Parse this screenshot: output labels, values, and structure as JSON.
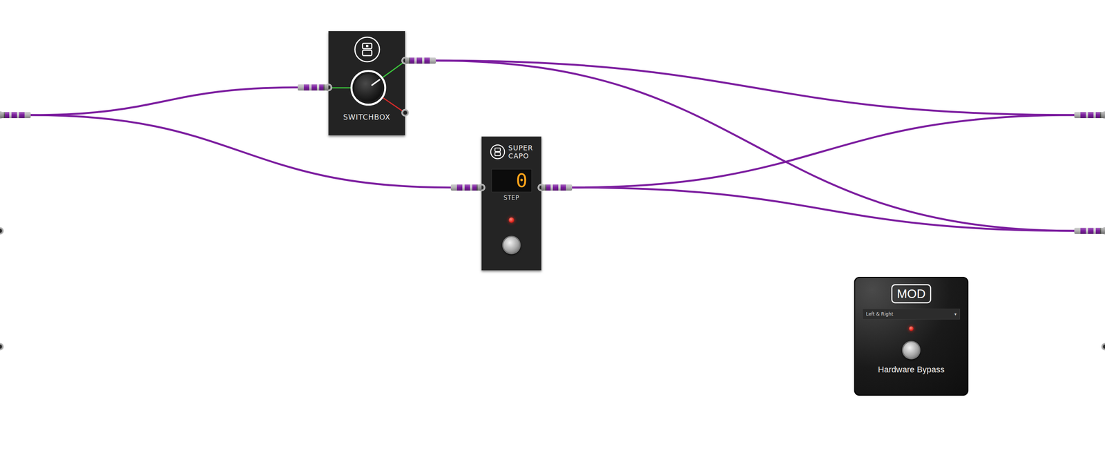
{
  "inputs": [
    {
      "connected": true
    },
    {
      "connected": false
    },
    {
      "connected": false
    }
  ],
  "outputs": [
    {
      "connected": true
    },
    {
      "connected": true
    },
    {
      "connected": false
    }
  ],
  "switchbox": {
    "label": "SWITCHBOX",
    "outputs": [
      {
        "selected": true,
        "color": "#3bc43b"
      },
      {
        "selected": false,
        "color": "#d12a2a"
      }
    ]
  },
  "capo": {
    "label_lines": [
      "SUPER",
      "CAPO"
    ],
    "display": "0",
    "display_label": "STEP",
    "led_on": true
  },
  "bypass": {
    "logo": "MOD",
    "mode": "Left & Right",
    "mode_arrow": "▾",
    "led_on": true,
    "label": "Hardware Bypass"
  },
  "cables": [
    {
      "from": "inputs.0",
      "to": "switchbox.in"
    },
    {
      "from": "inputs.0",
      "to": "capo.in"
    },
    {
      "from": "switchbox.out0",
      "to": "outputs.0"
    },
    {
      "from": "switchbox.out0",
      "to": "outputs.1"
    },
    {
      "from": "capo.out",
      "to": "outputs.0"
    },
    {
      "from": "capo.out",
      "to": "outputs.1"
    }
  ]
}
